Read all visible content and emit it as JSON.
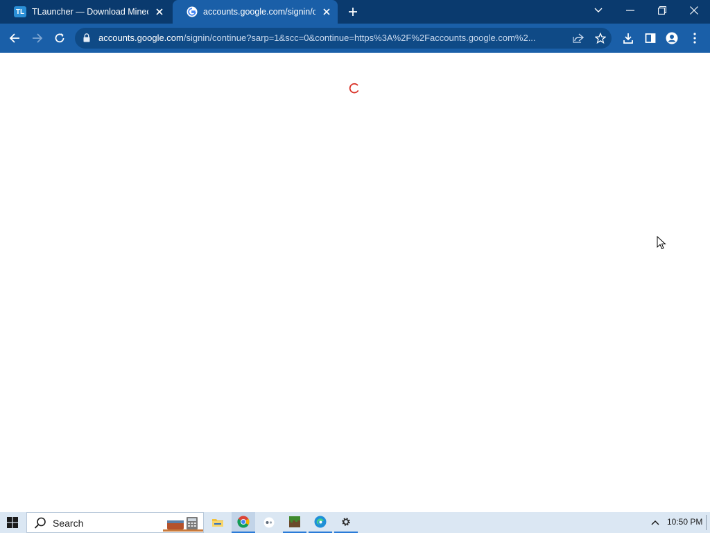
{
  "browser": {
    "tabs": [
      {
        "title": "TLauncher — Download Minecraft",
        "favicon": "tlauncher-logo-icon",
        "favicon_text": "TL",
        "active": false
      },
      {
        "title": "accounts.google.com/signin/continue",
        "favicon": "google-g-icon",
        "active": true
      }
    ],
    "url": {
      "host": "accounts.google.com",
      "path": "/signin/continue?sarp=1&scc=0&continue=https%3A%2F%2Faccounts.google.com%2..."
    },
    "colors": {
      "frame": "#0a3a6e",
      "toolbar": "#1a5fa8",
      "omnibox": "#0f4a86",
      "spinner": "#d93025"
    }
  },
  "page": {
    "state": "loading",
    "spinner_icon": "loading-spinner-icon"
  },
  "taskbar": {
    "search_placeholder": "Search",
    "apps": [
      "file-explorer-icon",
      "chrome-icon",
      "capture-app-icon",
      "minecraft-icon",
      "edge-icon",
      "settings-icon"
    ],
    "clock": "10:50 PM"
  }
}
